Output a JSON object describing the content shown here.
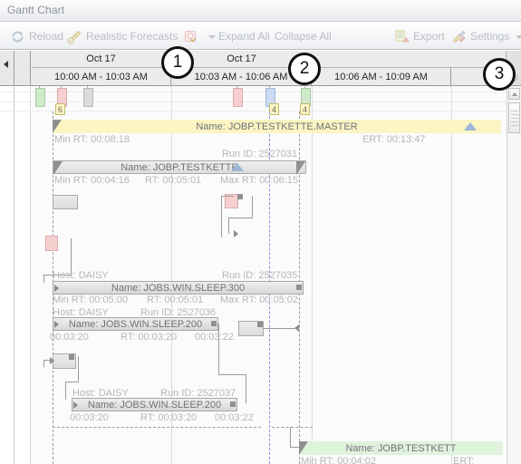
{
  "window": {
    "title": "Gantt Chart"
  },
  "toolbar": {
    "reload": "Reload",
    "forecasts": "Realistic Forecasts",
    "filter": "",
    "expand_all": "Expand All",
    "collapse_all": "Collapse All",
    "export": "Export",
    "settings": "Settings"
  },
  "timeline": {
    "days": [
      {
        "label": "Oct 17"
      },
      {
        "label": "Oct 17"
      }
    ],
    "slots": [
      {
        "label": "10:00 AM - 10:03 AM"
      },
      {
        "label": "10:03 AM - 10:06 AM"
      },
      {
        "label": "10:06 AM - 10:09 AM"
      }
    ]
  },
  "markers": [
    {
      "color": "#cfe9cb",
      "badge": null
    },
    {
      "color": "#f6cfcf",
      "badge": "6"
    },
    {
      "color": "#d8d8d8",
      "badge": null
    },
    {
      "color": "#f6cfcf",
      "badge": null
    },
    {
      "color": "#cbd9f2",
      "badge": "4"
    },
    {
      "color": "#cfe9cb",
      "badge": "4"
    }
  ],
  "rows": [
    {
      "name": "Name: JOBP.TESTKETTE.MASTER",
      "type": "master",
      "meta_left": "Min RT: 00:08:18",
      "meta_center": "ERT: 00:13:47",
      "meta_right": "Run ID: 2527031"
    },
    {
      "name": "Name: JOBP.TESTKETTE",
      "type": "group",
      "meta_left": "Min RT: 00:04:16",
      "meta_center": "RT: 00:05:01",
      "meta_right": "Max RT: 00:06:15"
    },
    {
      "name": "Name: JOBS.WIN.SLEEP.300",
      "type": "job",
      "host": "Host: DAISY",
      "run_id": "Run ID: 2527035",
      "meta_left": "Min RT: 00:05:00",
      "meta_center": "RT: 00:05:01",
      "meta_right": "Max RT: 00:05:02"
    },
    {
      "name": "Name: JOBS.WIN.SLEEP.200",
      "type": "job",
      "host": "Host: DAISY",
      "run_id": "Run ID: 2527036",
      "meta_left": "00:03:20",
      "meta_center": "RT: 00:03:20",
      "meta_right": "00:03:22"
    },
    {
      "name": "Name: JOBS.WIN.SLEEP.200",
      "type": "job",
      "host": "Host: DAISY",
      "run_id": "Run ID: 2527037",
      "meta_left": "00:03:20",
      "meta_center": "RT: 00:03:20",
      "meta_right": "00:03:22"
    },
    {
      "name": "Name: JOBP.TESTKETT",
      "type": "green",
      "meta_left": "Min RT: 00:04:02",
      "meta_center": "ERT:",
      "meta_right": ""
    }
  ],
  "callouts": [
    {
      "label": "1"
    },
    {
      "label": "2"
    },
    {
      "label": "3"
    }
  ],
  "colors": {
    "master_bar": "#fcf4c2",
    "green_bar": "#dff3dc",
    "group_bar": "#e4e4e4",
    "badge": "#fdf5c8",
    "accent_triangle": "#9db7d8"
  }
}
